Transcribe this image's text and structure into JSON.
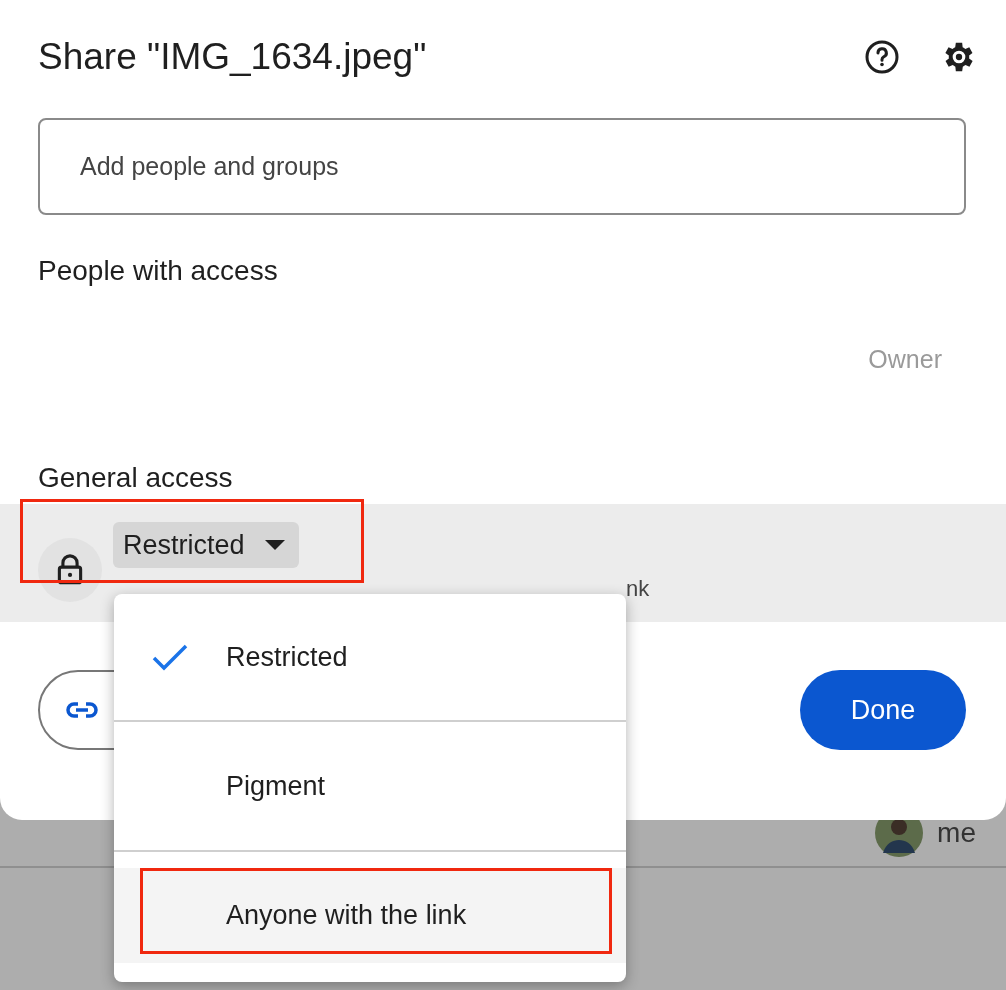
{
  "dialog": {
    "title": "Share \"IMG_1634.jpeg\"",
    "search": {
      "placeholder": "Add people and groups"
    },
    "people_heading": "People with access",
    "owner_role": "Owner",
    "general_heading": "General access",
    "access": {
      "value": "Restricted",
      "annotated": true,
      "description": "nk"
    },
    "menu": [
      {
        "label": "Restricted",
        "selected": true,
        "annotated": false
      },
      {
        "label": "Pigment",
        "selected": false,
        "annotated": false
      },
      {
        "label": "Anyone with the link",
        "selected": false,
        "annotated": true
      }
    ],
    "done_button": "Done"
  },
  "background": {
    "user_label": "me"
  }
}
